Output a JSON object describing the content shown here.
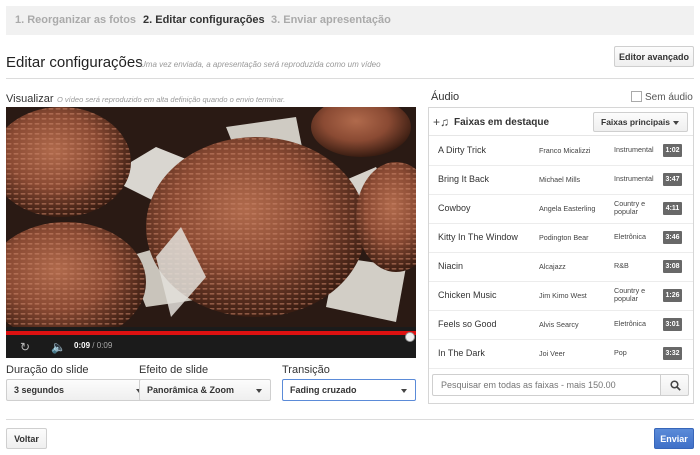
{
  "steps": [
    {
      "label": "1. Reorganizar as fotos"
    },
    {
      "label": "2. Editar configurações"
    },
    {
      "label": "3. Enviar apresentação"
    }
  ],
  "header": {
    "title": "Editar configurações",
    "subtitle": "Uma vez enviada, a apresentação será reproduzida como um vídeo",
    "advanced_label": "Editor avançado"
  },
  "preview": {
    "label": "Visualizar",
    "note": "O vídeo será reproduzido em alta definição quando o envio terminar.",
    "time_current": "0:09",
    "time_total": "/ 0:09",
    "progress": 1.0
  },
  "settings": {
    "duration_label": "Duração do slide",
    "duration_value": "3 segundos",
    "effect_label": "Efeito de slide",
    "effect_value": "Panorâmica & Zoom",
    "transition_label": "Transição",
    "transition_value": "Fading cruzado"
  },
  "audio": {
    "label": "Áudio",
    "no_audio_label": "Sem áudio",
    "featured_label": "Faixas em destaque",
    "top_tracks_label": "Faixas principais",
    "tracks": [
      {
        "name": "A Dirty Trick",
        "artist": "Franco Micalizzi",
        "genre": "Instrumental",
        "duration": "1:02"
      },
      {
        "name": "Bring It Back",
        "artist": "Michael Mills",
        "genre": "Instrumental",
        "duration": "3:47"
      },
      {
        "name": "Cowboy",
        "artist": "Angela Easterling",
        "genre": "Country e popular",
        "duration": "4:11"
      },
      {
        "name": "Kitty In The Window",
        "artist": "Podington Bear",
        "genre": "Eletrônica",
        "duration": "3:46"
      },
      {
        "name": "Niacin",
        "artist": "Alcajazz",
        "genre": "R&B",
        "duration": "3:08"
      },
      {
        "name": "Chicken Music",
        "artist": "Jim Kimo West",
        "genre": "Country e popular",
        "duration": "1:26"
      },
      {
        "name": "Feels so Good",
        "artist": "Alvis Searcy",
        "genre": "Eletrônica",
        "duration": "3:01"
      },
      {
        "name": "In The Dark",
        "artist": "Joi Veer",
        "genre": "Pop",
        "duration": "3:32"
      }
    ],
    "search_placeholder": "Pesquisar em todas as faixas - mais 150.00"
  },
  "footer": {
    "back_label": "Voltar",
    "send_label": "Enviar"
  },
  "colors": {
    "accent": "#3f70c8",
    "progress": "#dd1111",
    "duration_badge": "#686868"
  }
}
